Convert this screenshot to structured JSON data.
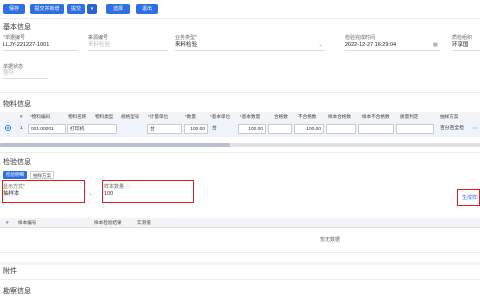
{
  "toolbar": {
    "save_label": "保存",
    "save_new_label": "提交并新增",
    "submit_label": "提交",
    "select_label": "选择",
    "exit_label": "退出"
  },
  "basic": {
    "title": "基本信息",
    "doc_no_label": "单据编号",
    "doc_no_value": "LLJY-221227-1001",
    "source_no_label": "来源编号",
    "source_no_placeholder": "来料检验",
    "biz_type_label": "业务类型",
    "biz_type_value": "来料检验",
    "finish_time_label": "检验完成时间",
    "finish_time_value": "2022-12-27 16:29:04",
    "org_label": "质检组织",
    "org_value": "环享国",
    "doc_status_label": "单据状态",
    "doc_status_value": "暂存"
  },
  "material": {
    "title": "物料信息",
    "columns": [
      "#",
      "*物料编码",
      "物料名称",
      "物料类型",
      "规格型号",
      "*计量单位",
      "*数量",
      "*基本单位",
      "*基本数量",
      "合格数",
      "不合格数",
      "样本合格数",
      "样本不合格数",
      "质量判定",
      "抽样方案"
    ],
    "row": {
      "index": "1",
      "code": "001.00001",
      "name": "打印机",
      "type": "",
      "spec": "",
      "unit": "台",
      "qty": "100.00",
      "base_unit": "台",
      "base_qty": "100.00",
      "qualified": "",
      "unqualified": "100.00",
      "sample_ok": "",
      "sample_ng": "",
      "judgement": "",
      "scheme": "百分百全检"
    }
  },
  "inspection": {
    "title": "检验信息",
    "tab_detail": "检验明细",
    "tab_scheme": "抽样方案",
    "display_mode_label": "显示方式",
    "display_mode_value": "抽样本",
    "sample_qty_label": "样本数量",
    "sample_qty_value": "100",
    "generate_label": "生成样本",
    "columns": [
      "#",
      "样本编号",
      "样本检验结果",
      "实测值"
    ],
    "empty_text": "暂无数据"
  },
  "attachment": {
    "title": "附件"
  },
  "change": {
    "title": "勘察信息"
  }
}
